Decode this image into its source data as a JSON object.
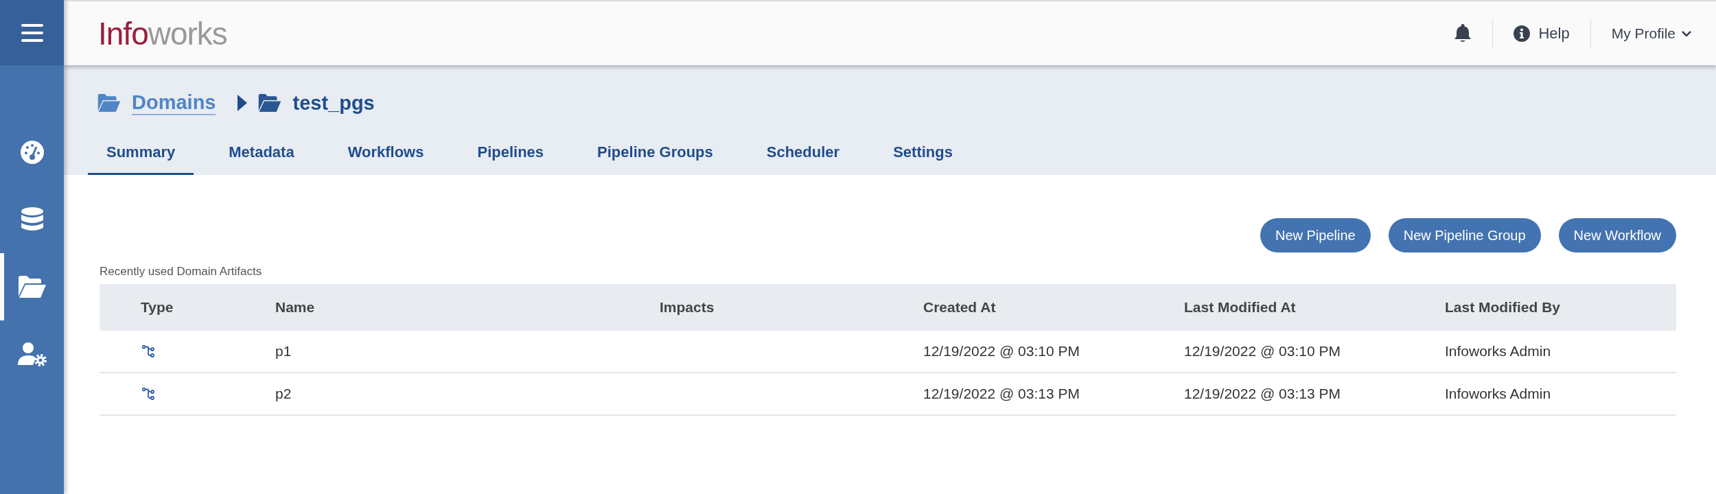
{
  "sidebar": {
    "items": [
      {
        "kind": "dashboard",
        "selected": false
      },
      {
        "kind": "database",
        "selected": false
      },
      {
        "kind": "folder",
        "selected": true
      },
      {
        "kind": "user-settings",
        "selected": false
      }
    ]
  },
  "header": {
    "logo": {
      "primary": "Info",
      "secondary": "works"
    },
    "help": "Help",
    "profile": "My Profile"
  },
  "breadcrumb": [
    {
      "label": "Domains",
      "link": true
    },
    {
      "label": "test_pgs",
      "link": false
    }
  ],
  "tabs": [
    {
      "label": "Summary",
      "selected": true
    },
    {
      "label": "Metadata",
      "selected": false
    },
    {
      "label": "Workflows",
      "selected": false
    },
    {
      "label": "Pipelines",
      "selected": false
    },
    {
      "label": "Pipeline Groups",
      "selected": false
    },
    {
      "label": "Scheduler",
      "selected": false
    },
    {
      "label": "Settings",
      "selected": false
    }
  ],
  "buttons": [
    "New Pipeline",
    "New Pipeline Group",
    "New Workflow"
  ],
  "table": {
    "caption": "Recently used Domain Artifacts",
    "columns": [
      "Type",
      "Name",
      "Impacts",
      "Created At",
      "Last Modified At",
      "Last Modified By"
    ],
    "rows": [
      {
        "kind": "pipeline",
        "name": "p1",
        "impacts": "",
        "created": "12/19/2022 @ 03:10 PM",
        "modified": "12/19/2022 @ 03:10 PM",
        "modified_by": "Infoworks Admin"
      },
      {
        "kind": "pipeline",
        "name": "p2",
        "impacts": "",
        "created": "12/19/2022 @ 03:13 PM",
        "modified": "12/19/2022 @ 03:13 PM",
        "modified_by": "Infoworks Admin"
      }
    ]
  }
}
